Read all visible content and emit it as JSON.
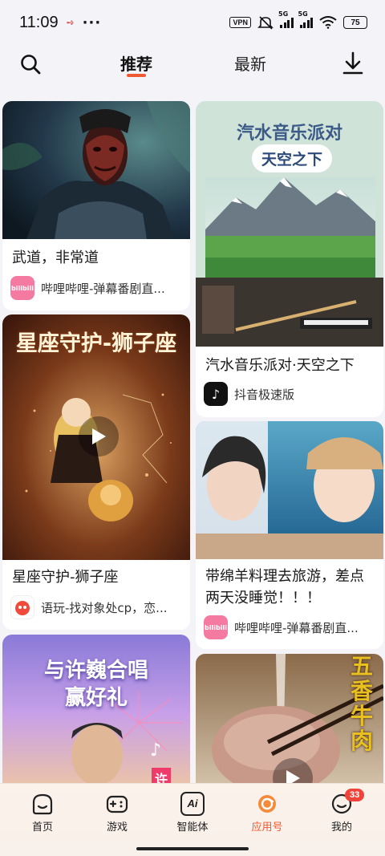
{
  "status_bar": {
    "time": "11:09",
    "dots": "···",
    "vpn": "VPN",
    "signal1": "5G",
    "signal2": "5G",
    "battery": "75"
  },
  "top_nav": {
    "tabs": [
      {
        "label": "推荐",
        "active": true
      },
      {
        "label": "最新",
        "active": false
      }
    ],
    "accent_color": "#f05a32"
  },
  "feed": {
    "cards": [
      {
        "title": "武道，非常道",
        "source": "哔哩哔哩-弹幕番剧直...",
        "app_icon": "bilibili-icon",
        "app_icon_text": "bilibili"
      },
      {
        "overlay_line1": "汽水音乐派对",
        "overlay_line2": "天空之下",
        "title": "汽水音乐派对·天空之下",
        "source": "抖音极速版",
        "app_icon": "douyin-lite-icon"
      },
      {
        "overlay_title": "星座守护-狮子座",
        "title": "星座守护-狮子座",
        "source": "语玩-找对象处cp，恋...",
        "app_icon": "yuwan-icon"
      },
      {
        "title_line1": "带绵羊料理去旅游，差点",
        "title_line2": "两天没睡觉！！！",
        "source": "哔哩哔哩-弹幕番剧直...",
        "app_icon": "bilibili-icon",
        "app_icon_text": "bilibili"
      },
      {
        "overlay_line1": "与许巍合唱",
        "overlay_line2": "赢好礼",
        "overlay_side": "许"
      },
      {
        "overlay_vertical": "五香牛肉"
      }
    ]
  },
  "bottom_nav": {
    "items": [
      {
        "label": "首页",
        "icon": "home-face-icon"
      },
      {
        "label": "游戏",
        "icon": "gamepad-icon"
      },
      {
        "label": "智能体",
        "icon": "ai-icon",
        "icon_text": "Ai"
      },
      {
        "label": "应用号",
        "icon": "app-channel-icon",
        "active": true
      },
      {
        "label": "我的",
        "icon": "profile-icon",
        "badge": "33"
      }
    ]
  }
}
